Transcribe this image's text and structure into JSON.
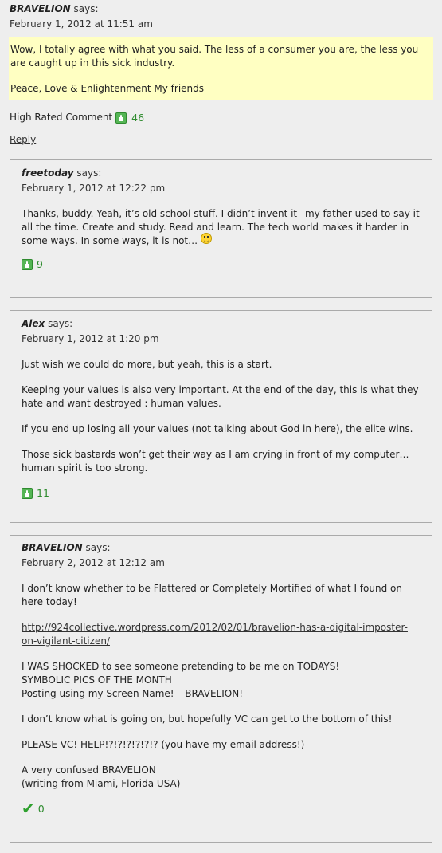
{
  "comments": [
    {
      "author": "BRAVELION",
      "says": "says:",
      "date": "February 1, 2012 at 11:51 am",
      "paragraphs": [
        "Wow, I totally agree with what you said. The less of a consumer you are, the less you are caught up in this sick industry.",
        "Peace, Love & Enlightenment My friends"
      ],
      "high_rated_label": "High Rated Comment",
      "votes": "46",
      "reply_label": "Reply"
    },
    {
      "author": "freetoday",
      "says": "says:",
      "date": "February 1, 2012 at 12:22 pm",
      "paragraphs": [
        "Thanks, buddy. Yeah, it’s old school stuff. I didn’t invent it– my father used to say it all the time. Create and study. Read and learn. The tech world makes it harder in some ways. In some ways, it is not…"
      ],
      "votes": "9"
    },
    {
      "author": "Alex",
      "says": "says:",
      "date": "February 1, 2012 at 1:20 pm",
      "paragraphs": [
        "Just wish we could do more, but yeah, this is a start.",
        "Keeping your values is also very important. At the end of the day, this is what they hate and want destroyed : human values.",
        "If you end up losing all your values (not talking about God in here), the elite wins.",
        "Those sick bastards won’t get their way as I am crying in front of my computer…human spirit is too strong."
      ],
      "votes": "11"
    },
    {
      "author": "BRAVELION",
      "says": "says:",
      "date": "February 2, 2012 at 12:12 am",
      "paragraphs": [
        "I don’t know whether to be Flattered or Completely Mortified of what I found on here today!",
        "http://924collective.wordpress.com/2012/02/01/bravelion-has-a-digital-imposter-on-vigilant-citizen/",
        "I WAS SHOCKED to see someone pretending to be me on TODAYS! SYMBOLIC PICS OF THE MONTH Posting using my Screen Name! – BRAVELION!",
        "I don’t know what is going on, but hopefully VC can get to the bottom of this!",
        "PLEASE VC! HELP!?!?!?!?!?!? (you have my email address!)",
        "A very confused BRAVELION (writing from Miami, Florida USA)"
      ],
      "link_line1": "http://924collective.wordpress.com/2012/02/01/bravelion-has-a-digital-imposter-",
      "link_line2": "on-vigilant-citizen/",
      "shock_lines": [
        "I WAS SHOCKED to see someone pretending to be me on TODAYS!",
        "SYMBOLIC PICS OF THE MONTH",
        "Posting using my Screen Name! – BRAVELION!"
      ],
      "sign_lines": [
        "A very confused BRAVELION",
        "(writing from Miami, Florida USA)"
      ],
      "votes": "0"
    }
  ],
  "icons": {
    "thumb": "thumbs-up-icon",
    "check": "checkmark-icon",
    "smiley": "smiley-icon"
  },
  "colors": {
    "background": "#eeeeee",
    "highlight": "#ffffc2",
    "vote_green": "#2e8b2e"
  }
}
